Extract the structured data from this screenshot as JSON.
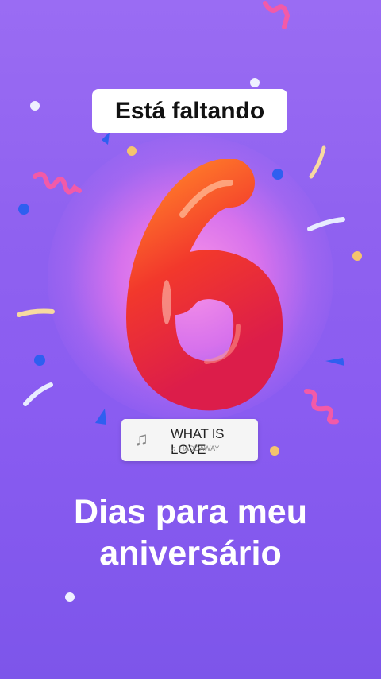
{
  "story": {
    "title": "Está faltando",
    "big_number": "6",
    "song": {
      "title": "WHAT IS LOVE",
      "artist": "HADDAWAY"
    },
    "caption_line1": "Dias para meu",
    "caption_line2": "aniversário"
  },
  "colors": {
    "background_top": "#9a6cf3",
    "background_bottom": "#7d55ea",
    "number_red": "#e9302f",
    "confetti_pink": "#f25aa8",
    "confetti_blue": "#2f5ff0",
    "confetti_yellow": "#f5c46e"
  },
  "icons": {
    "music_sticker": "music-note-icon"
  }
}
